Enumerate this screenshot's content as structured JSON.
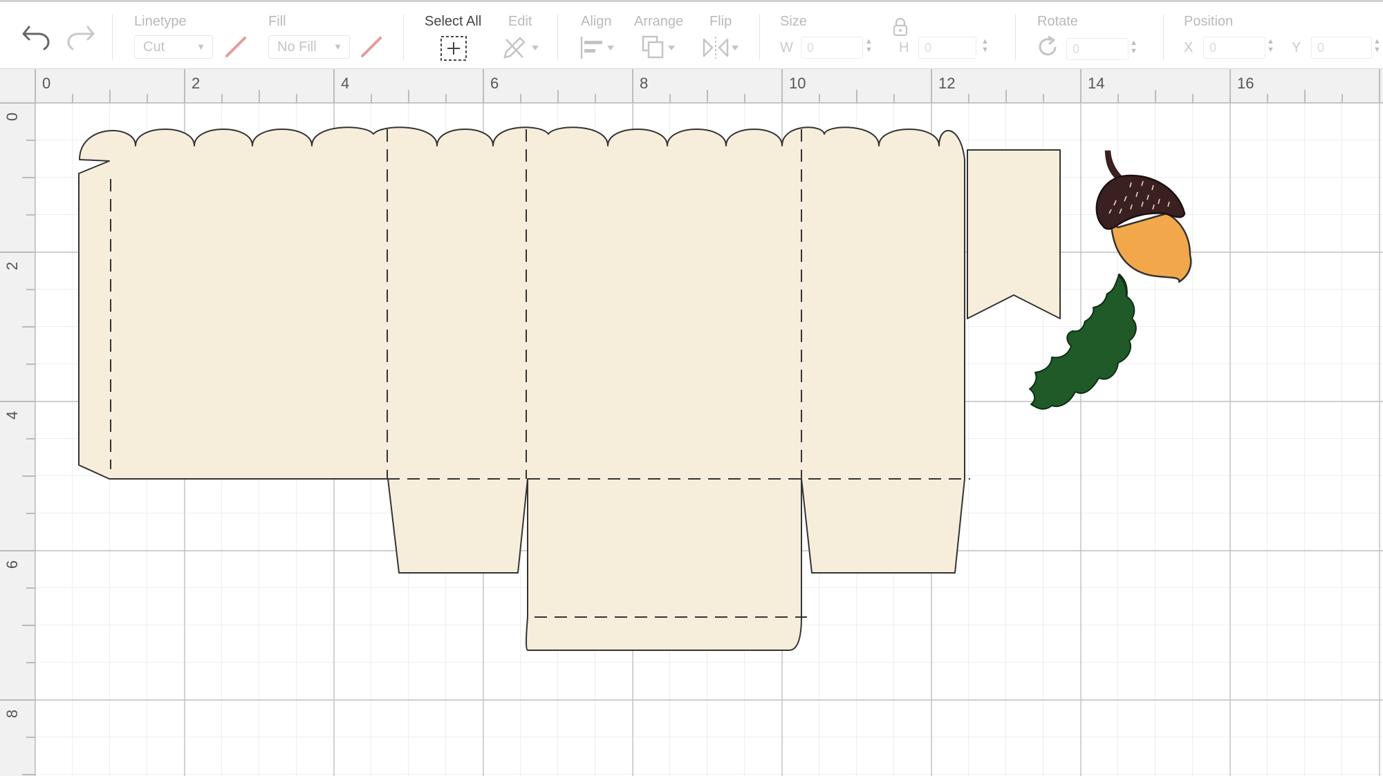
{
  "toolbar": {
    "linetype": {
      "label": "Linetype",
      "value": "Cut"
    },
    "fill": {
      "label": "Fill",
      "value": "No Fill"
    },
    "select_all": {
      "label": "Select All"
    },
    "edit": {
      "label": "Edit"
    },
    "align": {
      "label": "Align"
    },
    "arrange": {
      "label": "Arrange"
    },
    "flip": {
      "label": "Flip"
    },
    "size": {
      "label": "Size",
      "w_label": "W",
      "w_value": "0",
      "h_label": "H",
      "h_value": "0"
    },
    "rotate": {
      "label": "Rotate",
      "value": "0"
    },
    "position": {
      "label": "Position",
      "x_label": "X",
      "x_value": "0",
      "y_label": "Y",
      "y_value": "0"
    }
  },
  "ruler": {
    "horizontal": [
      "0",
      "2",
      "4",
      "6",
      "8",
      "10",
      "12",
      "14",
      "16"
    ],
    "vertical": [
      "0",
      "2",
      "4",
      "6",
      "8"
    ]
  },
  "canvas": {
    "objects": [
      {
        "name": "box-template",
        "fill": "#f6eedb",
        "stroke": "#333333"
      },
      {
        "name": "banner-tag",
        "fill": "#f6eedb",
        "stroke": "#333333"
      },
      {
        "name": "acorn",
        "cap_color": "#3a2020",
        "body_color": "#f2a84a"
      },
      {
        "name": "oak-leaf",
        "color": "#1f5a28"
      }
    ]
  },
  "colors": {
    "grid": "#d3d3d3",
    "ruler_bg": "#f1f1f1",
    "disabled_text": "#b9b9b9",
    "strike": "#e79a9a"
  }
}
